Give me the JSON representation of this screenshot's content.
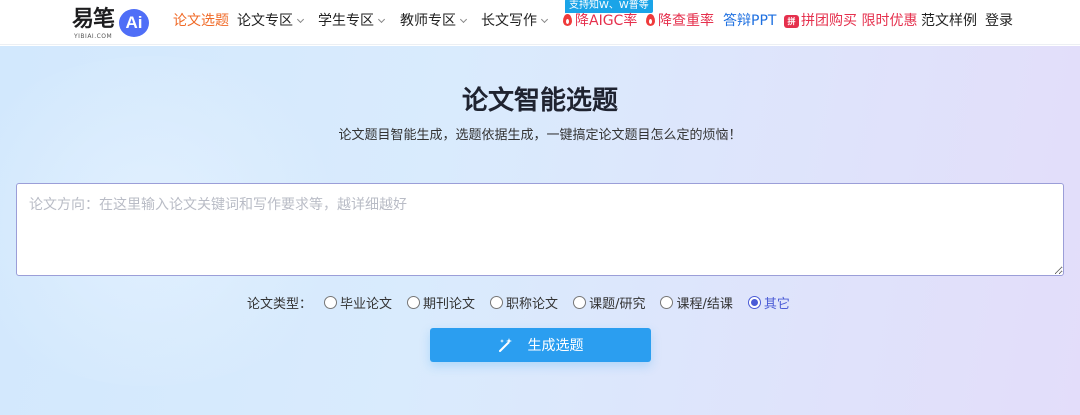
{
  "logo": {
    "text": "易笔",
    "ai": "Ai",
    "sub": "YIBIAI.COM"
  },
  "nav": {
    "topic": "论文选题",
    "thesis_zone": "论文专区",
    "student_zone": "学生专区",
    "teacher_zone": "教师专区",
    "long_writing": "长文写作",
    "aigc": "降AIGC率",
    "aigc_badge": "支持知W、W普等",
    "plagiarism": "降查重率",
    "ppt": "答辩PPT",
    "group_badge": "拼",
    "group_buy": "拼团购买 限时优惠",
    "samples": "范文样例",
    "login": "登录"
  },
  "main": {
    "title": "论文智能选题",
    "subtitle": "论文题目智能生成，选题依据生成，一键搞定论文题目怎么定的烦恼！",
    "input_placeholder": "论文方向：在这里输入论文关键词和写作要求等，越详细越好",
    "input_value": "",
    "type_label": "论文类型：",
    "types": [
      {
        "label": "毕业论文",
        "checked": false
      },
      {
        "label": "期刊论文",
        "checked": false
      },
      {
        "label": "职称论文",
        "checked": false
      },
      {
        "label": "课题/研究",
        "checked": false
      },
      {
        "label": "课程/结课",
        "checked": false
      },
      {
        "label": "其它",
        "checked": true
      }
    ],
    "generate_button": "生成选题"
  },
  "colors": {
    "accent": "#2b9ef0",
    "active_nav": "#f06a27",
    "hot": "#e5304d",
    "link_blue": "#1d6fe0",
    "radio_selected": "#4a5bd6"
  }
}
